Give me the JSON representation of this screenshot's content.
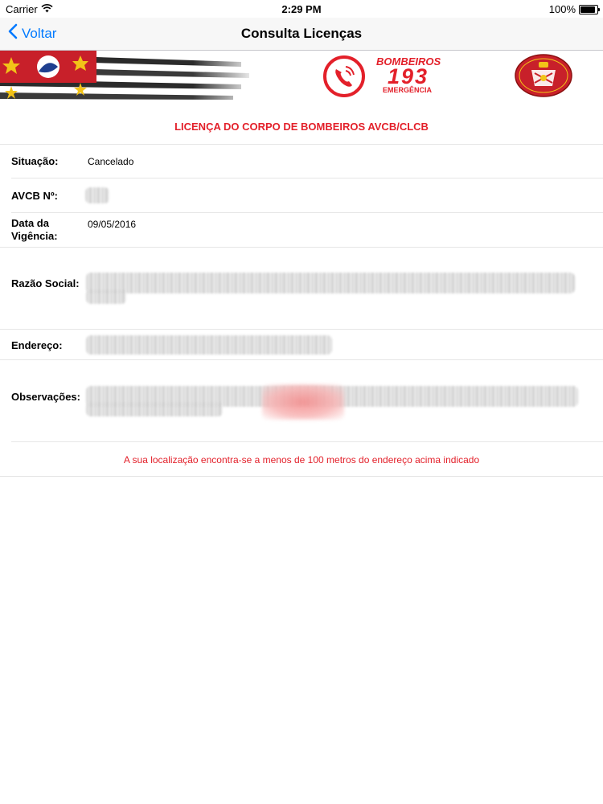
{
  "status_bar": {
    "carrier": "Carrier",
    "time": "2:29 PM",
    "battery": "100%",
    "battery_level": 1.0
  },
  "nav": {
    "back_label": "Voltar",
    "title": "Consulta Licenças"
  },
  "banner": {
    "emergency_label": "BOMBEIROS",
    "emergency_number": "193",
    "emergency_sub": "EMERGÊNCIA"
  },
  "license": {
    "heading": "LICENÇA DO CORPO DE BOMBEIROS AVCB/CLCB",
    "situacao_label": "Situação:",
    "situacao_value": "Cancelado",
    "avcb_label": "AVCB Nº:",
    "data_label_line1": "Data da",
    "data_label_line2": "Vigência:",
    "data_value": "09/05/2016",
    "razao_label": "Razão Social:",
    "endereco_label": "Endereço:",
    "observacoes_label": "Observações:",
    "location_note": "A sua localização encontra-se a menos de 100 metros do endereço acima indicado"
  },
  "colors": {
    "accent": "#e3202a",
    "ios_blue": "#007aff"
  },
  "icons": [
    "wifi-icon",
    "battery-icon",
    "chevron-left-icon",
    "phone-icon",
    "fire-department-crest"
  ]
}
